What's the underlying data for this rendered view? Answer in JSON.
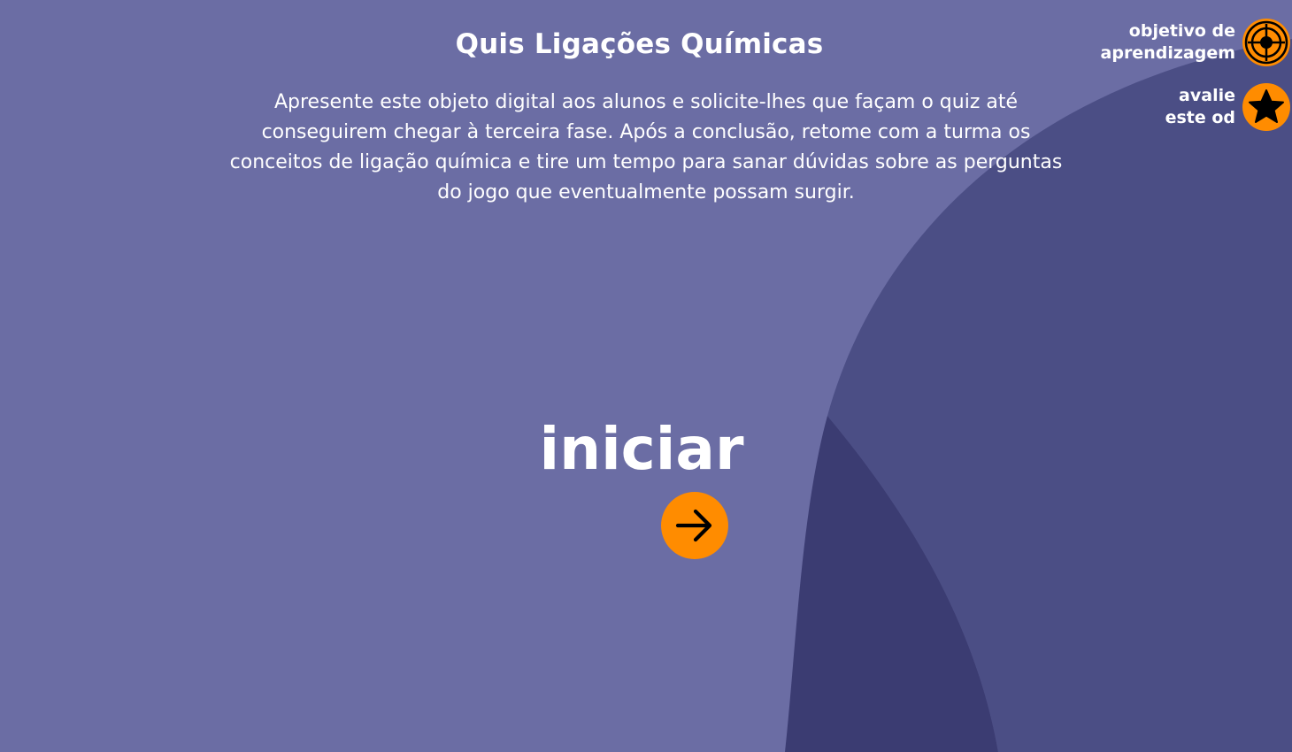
{
  "title": "Quis Ligações Químicas",
  "description": "Apresente este objeto digital aos alunos e solicite-lhes que façam o quiz até conseguirem chegar à terceira fase. Após a conclusão, retome com a turma os conceitos de ligação química e tire um tempo para sanar dúvidas sobre as perguntas do jogo que eventualmente possam surgir.",
  "start": {
    "label": "iniciar",
    "icon": "arrow-right-icon"
  },
  "side_links": {
    "objective": {
      "line1": "objetivo de",
      "line2": "aprendizagem",
      "icon": "target-icon"
    },
    "rate": {
      "line1": "avalie",
      "line2": "este od",
      "icon": "star-icon"
    }
  },
  "colors": {
    "background": "#6b6da4",
    "wave_mid": "#4b4e85",
    "wave_dark": "#3b3c72",
    "accent": "#ff8c00",
    "text": "#ffffff",
    "icon": "#000000"
  }
}
